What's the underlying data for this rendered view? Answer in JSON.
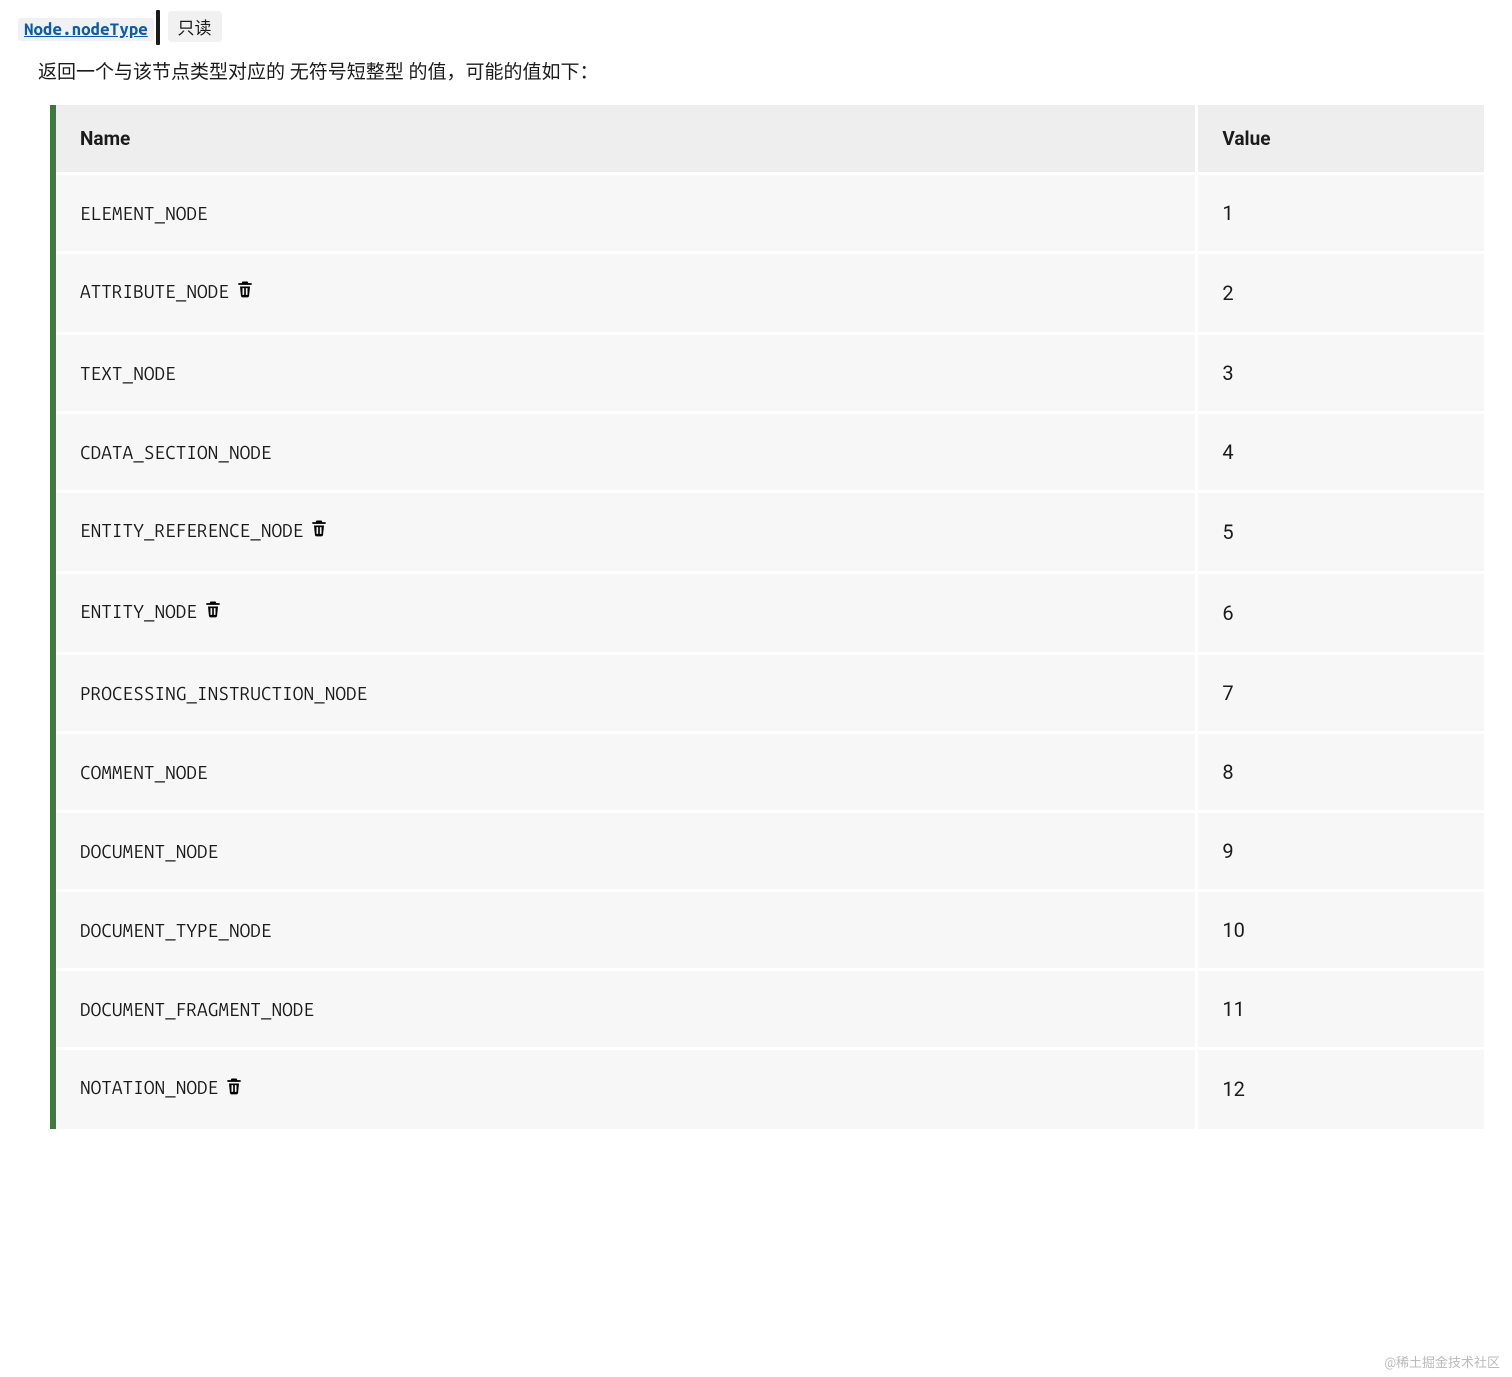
{
  "header": {
    "code_link": "Node.nodeType",
    "readonly_badge": "只读"
  },
  "description": {
    "prefix": "返回一个与该节点类型对应的 ",
    "emph": "无符号短整型 ",
    "suffix": "的值，可能的值如下："
  },
  "table": {
    "columns": {
      "name": "Name",
      "value": "Value"
    },
    "rows": [
      {
        "name": "ELEMENT_NODE",
        "value": "1",
        "deprecated": false
      },
      {
        "name": "ATTRIBUTE_NODE",
        "value": "2",
        "deprecated": true
      },
      {
        "name": "TEXT_NODE",
        "value": "3",
        "deprecated": false
      },
      {
        "name": "CDATA_SECTION_NODE",
        "value": "4",
        "deprecated": false
      },
      {
        "name": "ENTITY_REFERENCE_NODE",
        "value": "5",
        "deprecated": true
      },
      {
        "name": "ENTITY_NODE",
        "value": "6",
        "deprecated": true
      },
      {
        "name": "PROCESSING_INSTRUCTION_NODE",
        "value": "7",
        "deprecated": false
      },
      {
        "name": "COMMENT_NODE",
        "value": "8",
        "deprecated": false
      },
      {
        "name": "DOCUMENT_NODE",
        "value": "9",
        "deprecated": false
      },
      {
        "name": "DOCUMENT_TYPE_NODE",
        "value": "10",
        "deprecated": false
      },
      {
        "name": "DOCUMENT_FRAGMENT_NODE",
        "value": "11",
        "deprecated": false
      },
      {
        "name": "NOTATION_NODE",
        "value": "12",
        "deprecated": true
      }
    ]
  },
  "watermark": "@稀土掘金技术社区"
}
